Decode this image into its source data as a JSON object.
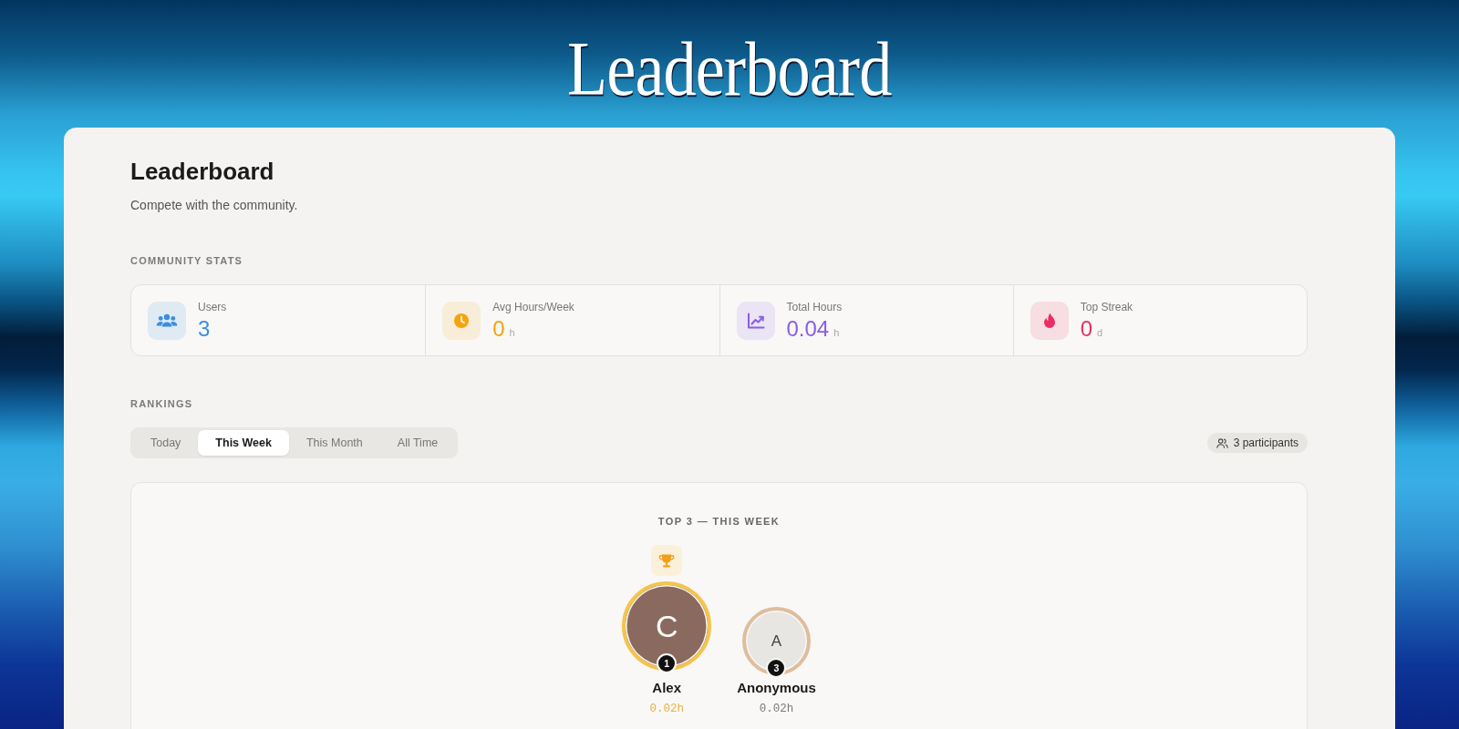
{
  "banner": {
    "title": "Leaderboard"
  },
  "header": {
    "title": "Leaderboard",
    "subtitle": "Compete with the community."
  },
  "community_stats": {
    "heading": "COMMUNITY STATS",
    "items": [
      {
        "kind": "users",
        "label": "Users",
        "value": "3",
        "color": "#3a8ee0"
      },
      {
        "kind": "clock",
        "label": "Avg Hours/Week",
        "value": "0",
        "unit": "h",
        "color": "#f5a30e"
      },
      {
        "kind": "chart",
        "label": "Total Hours",
        "value": "0.04",
        "unit": "h",
        "color": "#8a5ce6"
      },
      {
        "kind": "flame",
        "label": "Top Streak",
        "value": "0",
        "unit": "d",
        "color": "#ea2e63"
      }
    ]
  },
  "rankings": {
    "heading": "RANKINGS",
    "periods": [
      {
        "label": "Today",
        "selected": false
      },
      {
        "label": "This Week",
        "selected": true
      },
      {
        "label": "This Month",
        "selected": false
      },
      {
        "label": "All Time",
        "selected": false
      }
    ],
    "participants": "3 participants"
  },
  "podium": {
    "title": "TOP 3 — THIS WEEK",
    "entries": [
      {
        "kind": "gold",
        "rank": "1",
        "initial": "C",
        "name": "Alex",
        "hours": "0.02h",
        "color": "#8a6a5e"
      },
      {
        "kind": "bronze",
        "rank": "3",
        "initial": "A",
        "name": "Anonymous",
        "hours": "0.02h",
        "color": "#e8e6e3"
      }
    ]
  }
}
